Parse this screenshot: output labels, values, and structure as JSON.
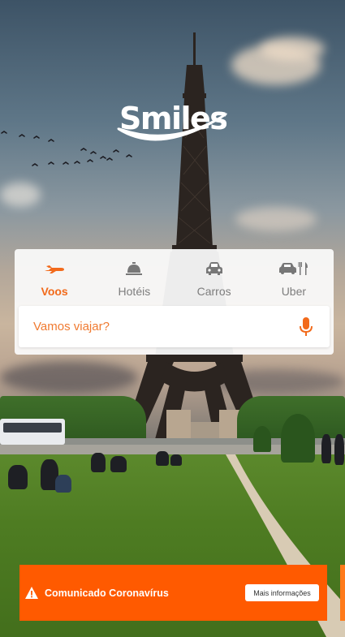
{
  "brand": {
    "logo_text": "Smiles",
    "accent": "#f26a1b",
    "banner_color": "#ff5a00"
  },
  "tabs": [
    {
      "label": "Voos",
      "icon": "airplane-icon",
      "active": true
    },
    {
      "label": "Hotéis",
      "icon": "hotel-bell-icon",
      "active": false
    },
    {
      "label": "Carros",
      "icon": "car-icon",
      "active": false
    },
    {
      "label": "Uber",
      "icon": "car-restaurant-icon",
      "active": false
    }
  ],
  "search": {
    "placeholder": "Vamos viajar?",
    "value": "",
    "mic_icon": "microphone-icon"
  },
  "banner": {
    "icon": "warning-icon",
    "text": "Comunicado Coronavírus",
    "button_label": "Mais informações"
  }
}
